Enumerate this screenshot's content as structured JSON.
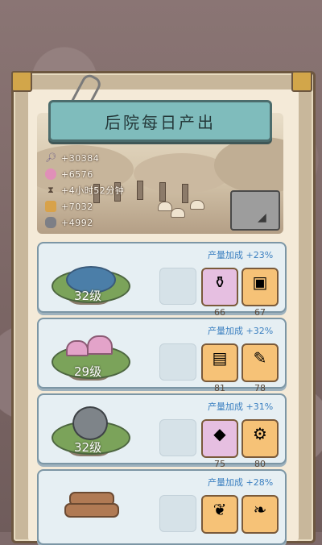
{
  "title": "后院每日产出",
  "stats": [
    {
      "icon": "magnifier-icon",
      "value": "+30384"
    },
    {
      "icon": "pink-gem-icon",
      "value": "+6576"
    },
    {
      "icon": "hourglass-icon",
      "value": "+4小时52分钟"
    },
    {
      "icon": "gold-coin-icon",
      "value": "+7032"
    },
    {
      "icon": "gray-stone-icon",
      "value": "+4992"
    }
  ],
  "cards": [
    {
      "level": "32级",
      "bonus": "产量加成 +23%",
      "items": [
        {
          "icon": "stone-jar-icon",
          "count": "66"
        },
        {
          "icon": "portrait-icon",
          "count": "67"
        }
      ],
      "island": "pond"
    },
    {
      "level": "29级",
      "bonus": "产量加成 +32%",
      "items": [
        {
          "icon": "framed-picture-icon",
          "count": "81"
        },
        {
          "icon": "scroll-icon",
          "count": "78"
        }
      ],
      "island": "mushrooms"
    },
    {
      "level": "32级",
      "bonus": "产量加成 +31%",
      "items": [
        {
          "icon": "crystal-icon",
          "count": "75"
        },
        {
          "icon": "cannon-icon",
          "count": "80"
        }
      ],
      "island": "ruins"
    },
    {
      "level": "",
      "bonus": "产量加成 +28%",
      "items": [
        {
          "icon": "branch-icon",
          "count": ""
        },
        {
          "icon": "leaf-icon",
          "count": ""
        }
      ],
      "island": "logs"
    }
  ]
}
